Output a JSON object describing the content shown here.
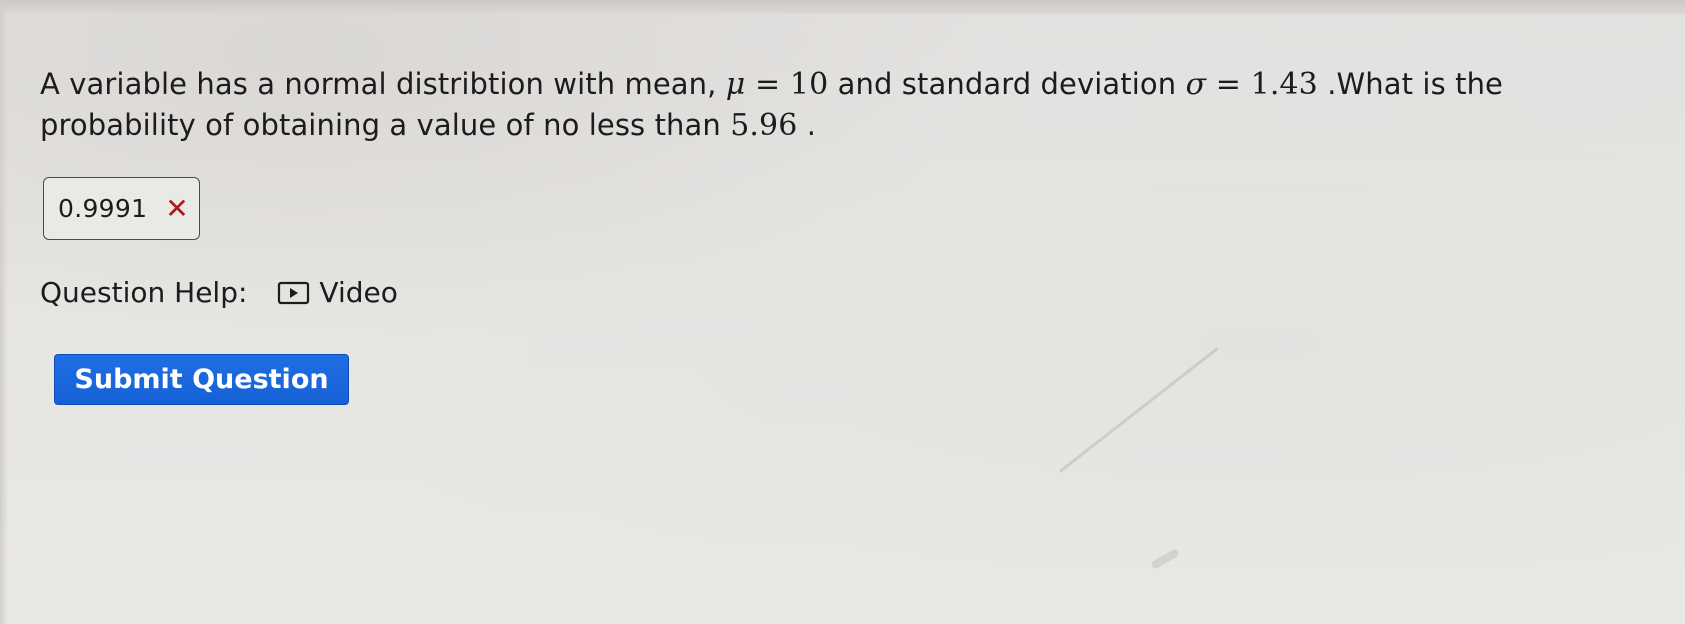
{
  "question": {
    "text_before_mu": "A variable has a normal distribtion with mean, ",
    "mu_symbol": "μ",
    "mu_equals": " = ",
    "mu_value": "10",
    "text_before_sigma": " and standard deviation ",
    "sigma_symbol": "σ",
    "sigma_equals": " = ",
    "sigma_value": "1.43",
    "text_after_sigma": " .What is the probability of obtaining a value of no less than ",
    "threshold_value": "5.96",
    "text_end": " ."
  },
  "answer": {
    "value": "0.9991",
    "status_icon": "x-mark-icon",
    "status": "incorrect",
    "status_color": "#b0181e"
  },
  "help": {
    "label": "Question Help:",
    "video_label": "Video",
    "video_icon": "play-video-icon"
  },
  "actions": {
    "submit_label": "Submit Question",
    "submit_color": "#1f6ee3"
  }
}
